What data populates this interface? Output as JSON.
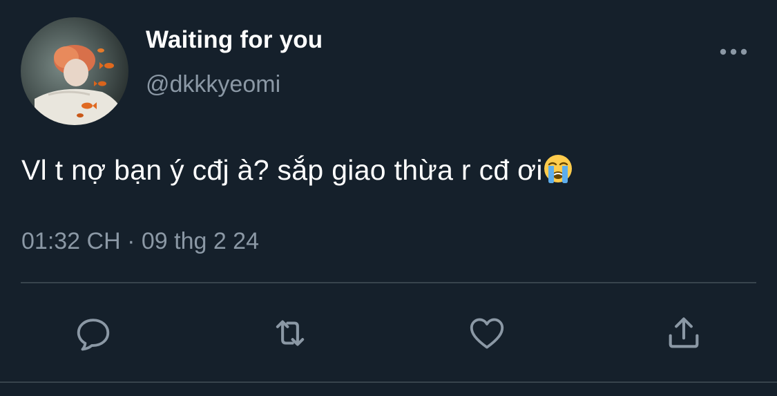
{
  "tweet": {
    "display_name": "Waiting for you",
    "handle": "@dkkkyeomi",
    "text": "Vl t nợ bạn ý cđj à? sắp giao thừa r cđ ơi",
    "emoji": "loudly-crying-face",
    "timestamp": "01:32 CH · 09 thg 2 24"
  },
  "actions": [
    {
      "name": "reply",
      "icon": "reply-icon"
    },
    {
      "name": "retweet",
      "icon": "retweet-icon"
    },
    {
      "name": "like",
      "icon": "heart-icon"
    },
    {
      "name": "share",
      "icon": "share-icon"
    }
  ],
  "colors": {
    "background": "#15202b",
    "primary_text": "#ffffff",
    "secondary_text": "#8b98a5",
    "divider": "#38444d"
  }
}
